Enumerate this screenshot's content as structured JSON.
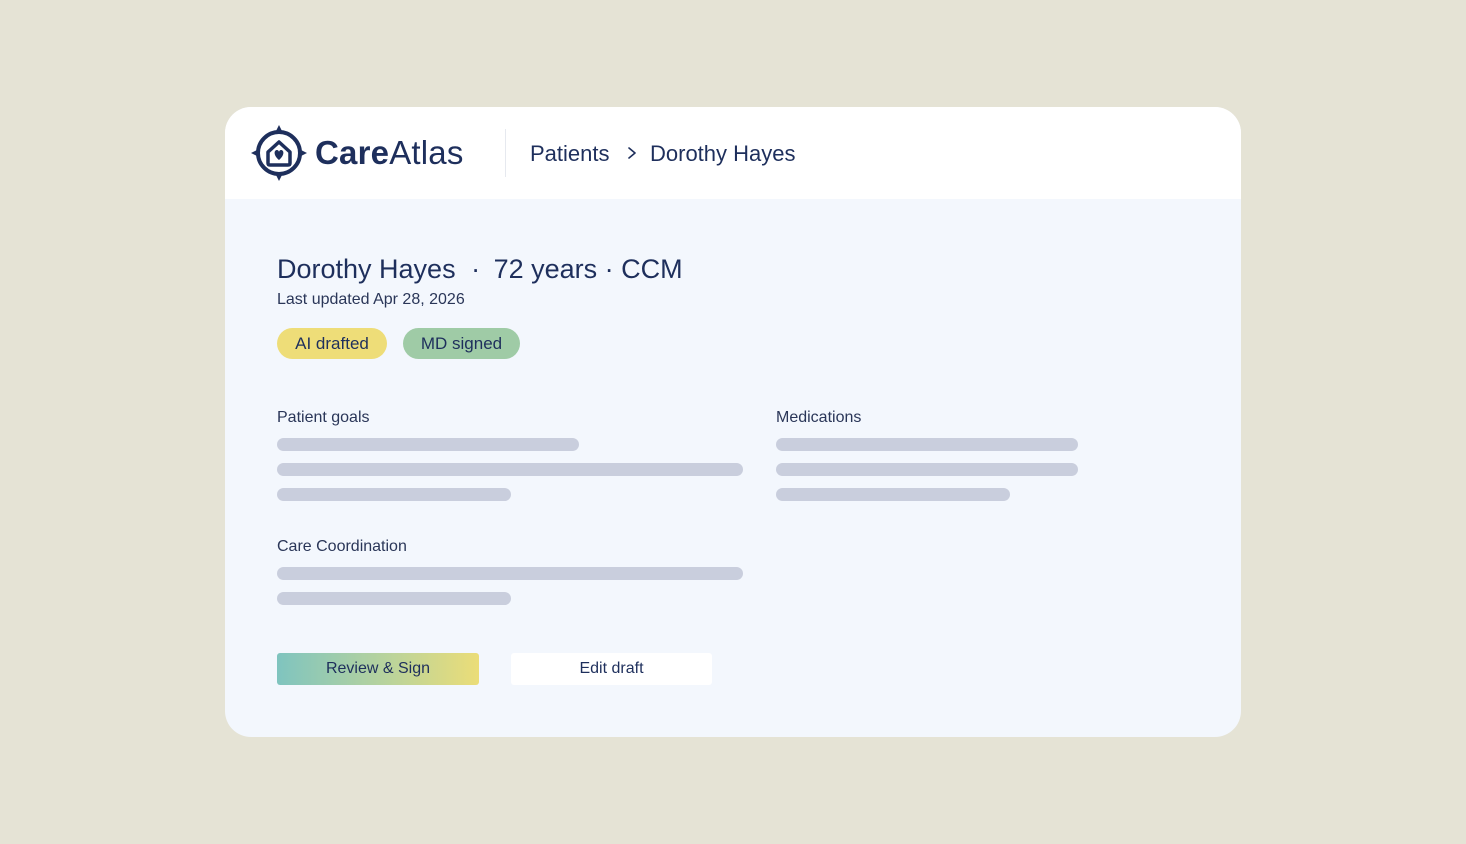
{
  "app": {
    "brand_bold": "Care",
    "brand_light": "Atlas",
    "logo_icon": "compass-home-heart-icon"
  },
  "breadcrumb": {
    "items": [
      "Patients",
      "Dorothy Hayes"
    ],
    "separator_icon": "chevron-right-icon"
  },
  "patient": {
    "name": "Dorothy Hayes",
    "details": "72 years · CCM",
    "last_updated": "Last updated Apr 28, 2026"
  },
  "badges": [
    {
      "label": "AI drafted",
      "color": "#eedd78"
    },
    {
      "label": "MD signed",
      "color": "#9fcba6"
    }
  ],
  "sections": {
    "patient_goals": "Patient goals",
    "medications": "Medications",
    "care_coordination": "Care Coordination"
  },
  "actions": {
    "review_sign": "Review & Sign",
    "edit_draft": "Edit draft"
  },
  "colors": {
    "page_background": "#e5e3d5",
    "card_background": "#f3f7fd",
    "brand_navy": "#1e2f5c",
    "skeleton": "#c9cedd"
  }
}
